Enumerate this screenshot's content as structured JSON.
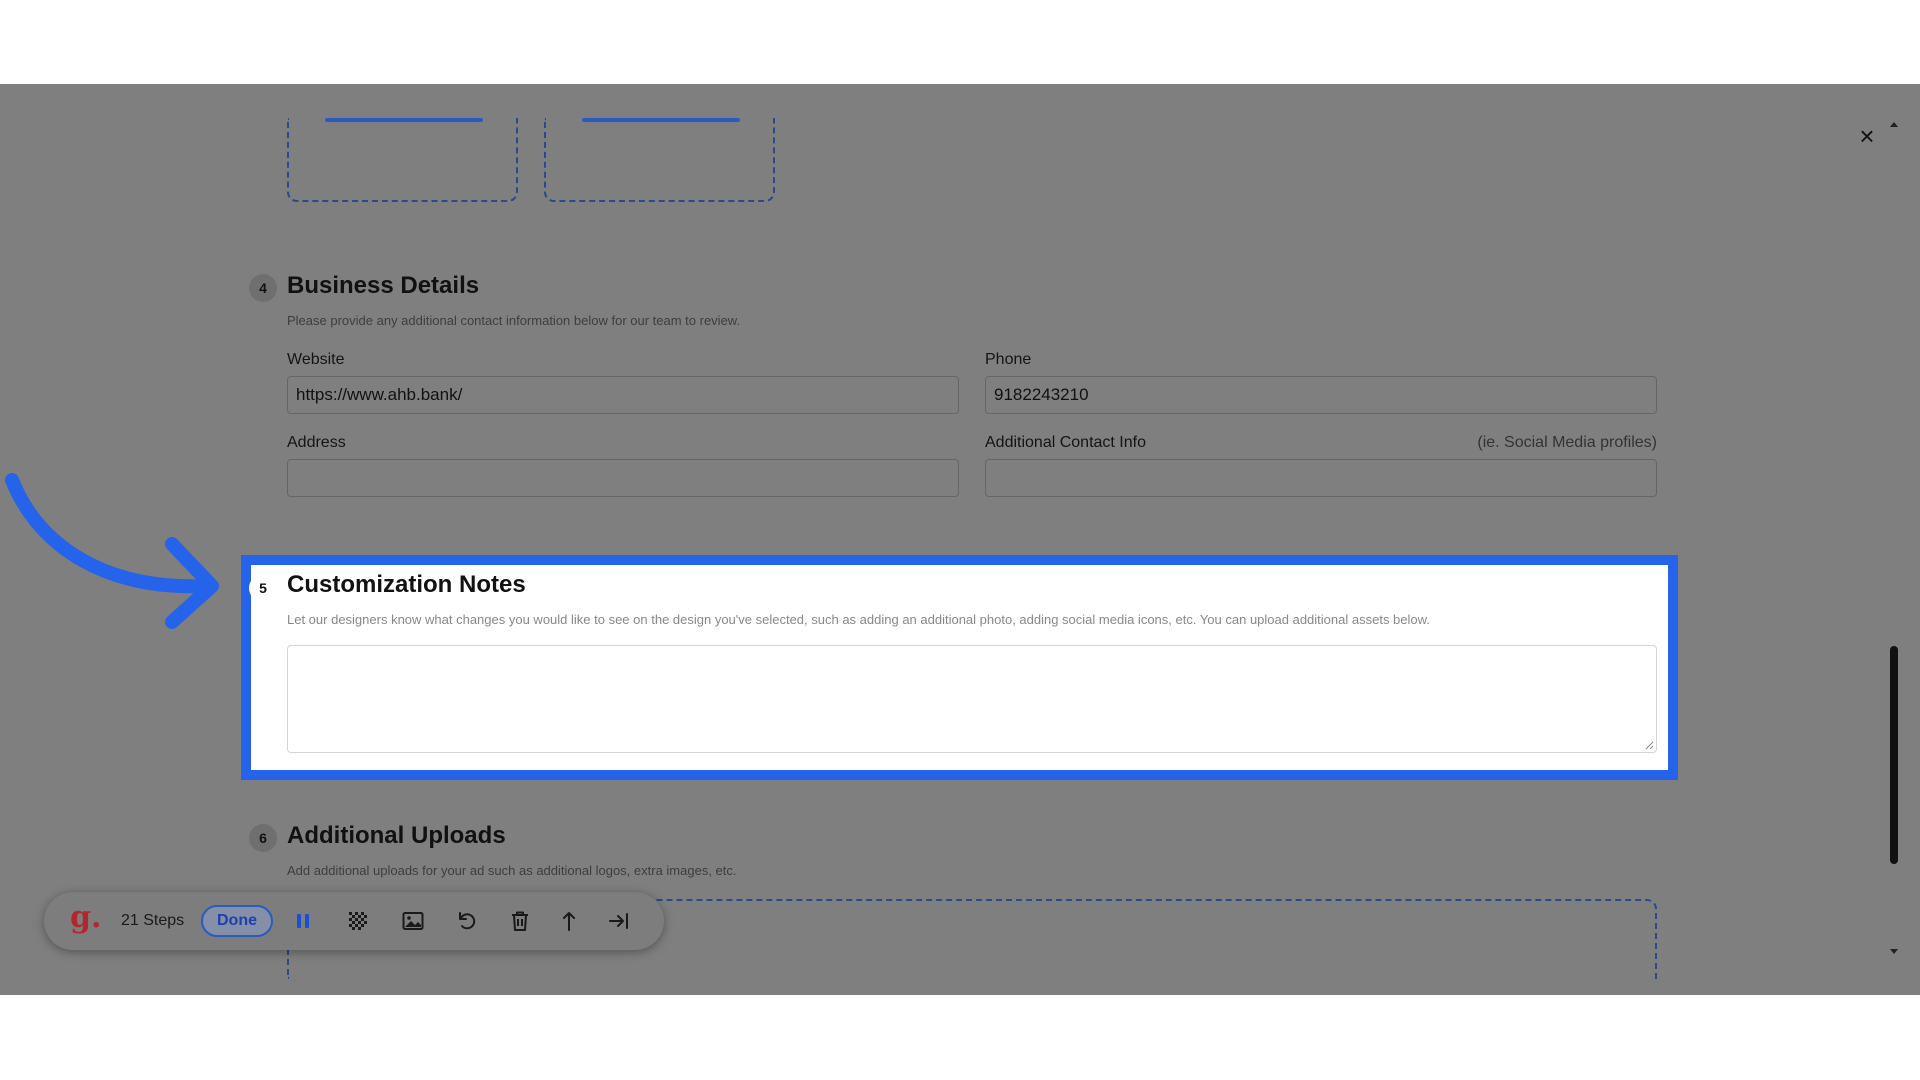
{
  "modal": {
    "close_glyph": "×"
  },
  "sections": {
    "business": {
      "number": "4",
      "title": "Business Details",
      "description": "Please provide any additional contact information below for our team to review.",
      "website_label": "Website",
      "website_value": "https://www.ahb.bank/",
      "phone_label": "Phone",
      "phone_value": "9182243210",
      "address_label": "Address",
      "address_value": "",
      "contact_label": "Additional Contact Info",
      "contact_hint": "(ie. Social Media profiles)",
      "contact_value": ""
    },
    "customization": {
      "number": "5",
      "title": "Customization Notes",
      "description": "Let our designers know what changes you would like to see on the design you've selected, such as adding an additional photo, adding social media icons, etc. You can upload additional assets below.",
      "notes_value": ""
    },
    "uploads": {
      "number": "6",
      "title": "Additional Uploads",
      "description": "Add additional uploads for your ad such as additional logos, extra images, etc."
    }
  },
  "toolbar": {
    "logo": "g.",
    "steps_label": "21 Steps",
    "done_label": "Done",
    "icons": [
      "pause-icon",
      "blur-icon",
      "image-icon",
      "undo-icon",
      "trash-icon",
      "upload-arrow-icon",
      "skip-to-end-icon"
    ]
  },
  "colors": {
    "overlay": "#7f7f7f",
    "highlight": "#2563eb",
    "logo": "#b3262e",
    "done_border": "#2a5bbf"
  }
}
